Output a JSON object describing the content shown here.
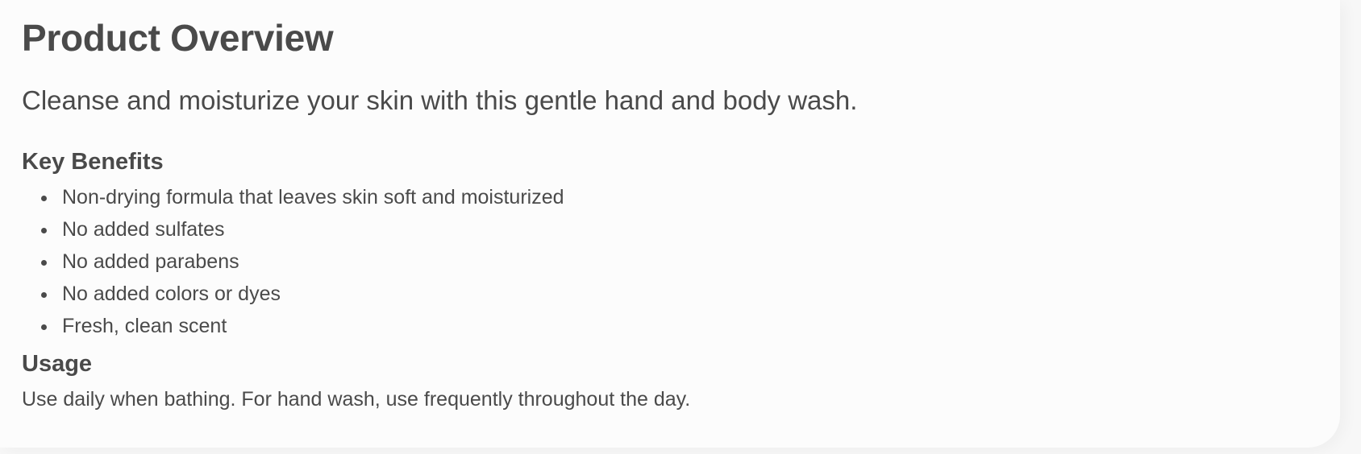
{
  "product_overview": {
    "title": "Product Overview",
    "subtitle": "Cleanse and moisturize your skin with this gentle hand and body wash.",
    "key_benefits": {
      "heading": "Key Benefits",
      "items": [
        "Non-drying formula that leaves skin soft and moisturized",
        "No added sulfates",
        "No added parabens",
        "No added colors or dyes",
        "Fresh, clean scent"
      ]
    },
    "usage": {
      "heading": "Usage",
      "text": "Use daily when bathing. For hand wash, use frequently throughout the day."
    }
  },
  "colors": {
    "text": "#4a4a4a",
    "background": "#fcfcfc"
  }
}
